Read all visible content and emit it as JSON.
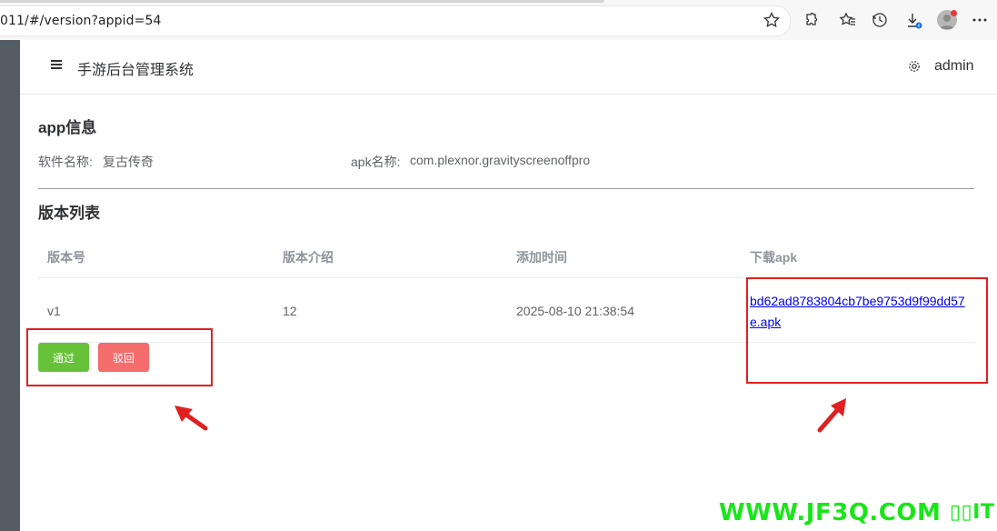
{
  "browser": {
    "url": "011/#/version?appid=54",
    "icons": [
      "star-icon",
      "extensions-icon",
      "favorites-icon",
      "history-icon",
      "download-icon",
      "profile-avatar",
      "more-icon"
    ]
  },
  "header": {
    "title": "手游后台管理系统",
    "user": "admin"
  },
  "app_info": {
    "section_title": "app信息",
    "name_label": "软件名称:",
    "name_value": "复古传奇",
    "apk_label": "apk名称:",
    "apk_value": "com.plexnor.gravityscreenoffpro"
  },
  "versions": {
    "section_title": "版本列表",
    "columns": [
      "版本号",
      "版本介绍",
      "添加时间",
      "下载apk"
    ],
    "rows": [
      {
        "version": "v1",
        "intro": "12",
        "added_time": "2025-08-10 21:38:54",
        "apk": "bd62ad8783804cb7be9753d9f99dd57e.apk"
      }
    ]
  },
  "actions": {
    "approve_label": "通过",
    "reject_label": "驳回"
  },
  "watermark": "WWW.JF3Q.COM",
  "colors": {
    "sidebar": "#545c64",
    "approve": "#67c23a",
    "reject": "#f56c6c",
    "annotation": "#e02020",
    "watermark": "#19e619"
  }
}
